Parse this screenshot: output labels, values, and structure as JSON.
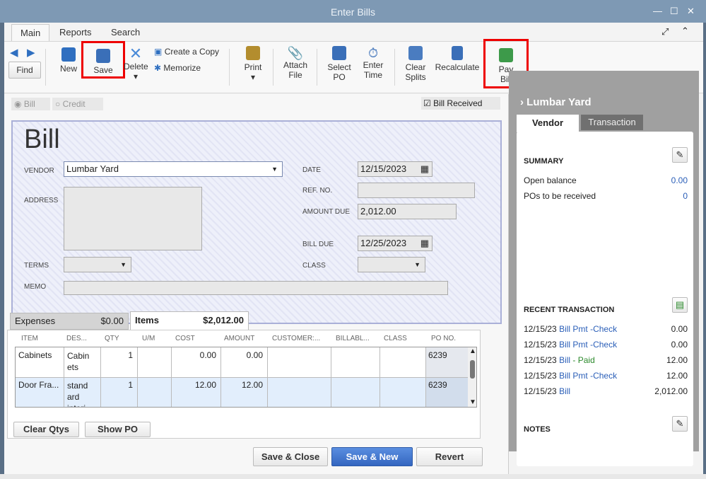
{
  "window": {
    "title": "Enter Bills"
  },
  "menu_tabs": [
    "Main",
    "Reports",
    "Search"
  ],
  "toolbar": {
    "find": "Find",
    "new": "New",
    "save": "Save",
    "delete": "Delete",
    "create_copy": "Create a Copy",
    "memorize": "Memorize",
    "print": "Print",
    "attach_file": [
      "Attach",
      "File"
    ],
    "select_po": [
      "Select",
      "PO"
    ],
    "enter_time": [
      "Enter",
      "Time"
    ],
    "clear_splits": [
      "Clear",
      "Splits"
    ],
    "recalculate": "Recalculate",
    "pay_bill": [
      "Pay",
      "Bill"
    ]
  },
  "type_options": {
    "bill": "Bill",
    "credit": "Credit",
    "bill_received": "Bill Received"
  },
  "form": {
    "title": "Bill",
    "vendor_label": "VENDOR",
    "vendor": "Lumbar Yard",
    "address_label": "ADDRESS",
    "terms_label": "TERMS",
    "memo_label": "MEMO",
    "date_label": "DATE",
    "date": "12/15/2023",
    "ref_label": "REF. NO.",
    "amount_due_label": "AMOUNT DUE",
    "amount_due": "2,012.00",
    "bill_due_label": "BILL DUE",
    "bill_due": "12/25/2023",
    "class_label": "CLASS"
  },
  "detail_tabs": {
    "expenses": "Expenses",
    "expenses_amount": "$0.00",
    "items": "Items",
    "items_amount": "$2,012.00"
  },
  "grid": {
    "headers": [
      "ITEM",
      "DES...",
      "QTY",
      "U/M",
      "COST",
      "AMOUNT",
      "CUSTOMER:...",
      "BILLABL...",
      "CLASS",
      "PO NO."
    ],
    "rows": [
      {
        "item": "Cabinets",
        "desc": "Cabin ets",
        "qty": "1",
        "cost": "0.00",
        "amount": "0.00",
        "po": "6239"
      },
      {
        "item": "Door Fra...",
        "desc": "stand ard interi",
        "qty": "1",
        "cost": "12.00",
        "amount": "12.00",
        "po": "6239"
      }
    ]
  },
  "buttons": {
    "clear_qtys": "Clear Qtys",
    "show_po": "Show PO",
    "save_close": "Save & Close",
    "save_new": "Save & New",
    "revert": "Revert"
  },
  "sidebar": {
    "vendor_name": "Lumbar Yard",
    "tabs": [
      "Vendor",
      "Transaction"
    ],
    "summary": "SUMMARY",
    "open_balance_label": "Open balance",
    "open_balance": "0.00",
    "pos_label": "POs to be received",
    "pos": "0",
    "recent": "RECENT TRANSACTION",
    "transactions": [
      {
        "date": "12/15/23",
        "type": "Bill Pmt -Check",
        "status": "",
        "amount": "0.00"
      },
      {
        "date": "12/15/23",
        "type": "Bill Pmt -Check",
        "status": "",
        "amount": "0.00"
      },
      {
        "date": "12/15/23",
        "type": "Bill",
        "status": " - Paid",
        "amount": "12.00"
      },
      {
        "date": "12/15/23",
        "type": "Bill Pmt -Check",
        "status": "",
        "amount": "12.00"
      },
      {
        "date": "12/15/23",
        "type": "Bill",
        "status": "",
        "amount": "2,012.00"
      }
    ],
    "notes": "NOTES"
  }
}
